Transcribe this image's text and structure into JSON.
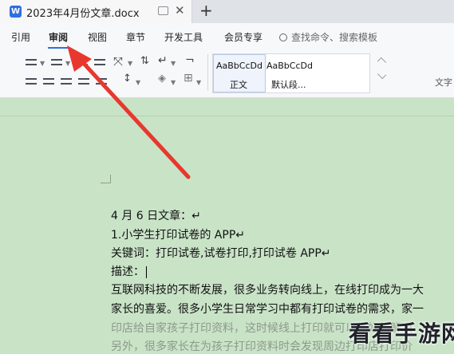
{
  "window": {
    "tab_title": "2023年4月份文章.docx",
    "app_icon_letter": "W",
    "new_tab_symbol": "+",
    "close_symbol": "✕"
  },
  "menu": {
    "items": [
      "引用",
      "审阅",
      "视图",
      "章节",
      "开发工具",
      "会员专享"
    ],
    "active_index": 1,
    "search_placeholder": "查找命令、搜索模板"
  },
  "ribbon": {
    "styles": [
      {
        "sample": "AaBbCcDd",
        "name": "正文"
      },
      {
        "sample": "AaBbCcDd",
        "name": "默认段..."
      }
    ],
    "right_label": "文字"
  },
  "document": {
    "lines": [
      "4 月 6 日文章：↵",
      "1.小学生打印试卷的 APP↵",
      "关键词：打印试卷,试卷打印,打印试卷 APP↵",
      "描述：",
      "互联网科技的不断发展，很多业务转向线上，在线打印成为一大",
      "家长的喜爱。很多小学生日常学习中都有打印试卷的需求，家一",
      "印店给自家孩子打印资料，这时候线上打印就可以很好的解决",
      "另外，很多家长在为孩子打印资料时会发现周边打印店打印价"
    ]
  },
  "colors": {
    "accent": "#2f6fe0",
    "arrow": "#e8382e",
    "page_bg": "#c9e3c7"
  },
  "watermark": "看看手游网"
}
